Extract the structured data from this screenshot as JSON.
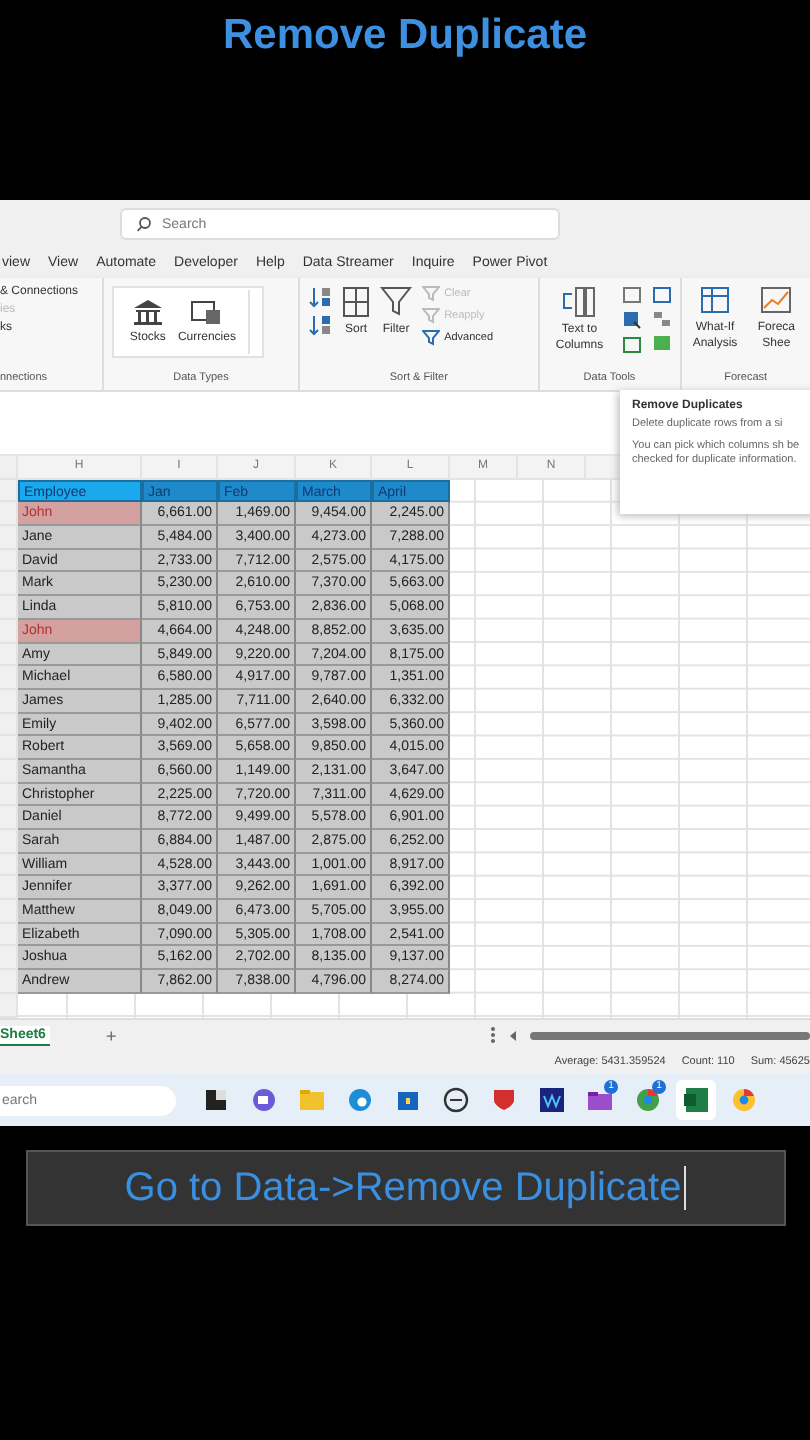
{
  "video_title": "Remove Duplicate",
  "search": {
    "placeholder": "Search"
  },
  "menu_tabs": [
    {
      "label": "view",
      "selected": false
    },
    {
      "label": "View",
      "selected": false
    },
    {
      "label": "Automate",
      "selected": false
    },
    {
      "label": "Developer",
      "selected": false
    },
    {
      "label": "Help",
      "selected": false
    },
    {
      "label": "Data Streamer",
      "selected": false
    },
    {
      "label": "Inquire",
      "selected": false
    },
    {
      "label": "Power Pivot",
      "selected": false
    }
  ],
  "ribbon": {
    "connections": {
      "items": [
        {
          "label": "& Connections",
          "disabled": false
        },
        {
          "label": "ies",
          "disabled": true
        },
        {
          "label": "ks",
          "disabled": false
        }
      ],
      "group": "nnections"
    },
    "data_types": {
      "buttons": [
        "Stocks",
        "Currencies"
      ],
      "group": "Data Types"
    },
    "sort_filter": {
      "sort": "Sort",
      "filter": "Filter",
      "items": [
        {
          "label": "Clear",
          "disabled": true
        },
        {
          "label": "Reapply",
          "disabled": true
        },
        {
          "label": "Advanced",
          "disabled": false
        }
      ],
      "group": "Sort & Filter"
    },
    "data_tools": {
      "text_to_columns": "Text to Columns",
      "group": "Data Tools"
    },
    "forecast": {
      "what_if": "What-If Analysis",
      "forecast_sheet": "Foreca Shee",
      "group": "Forecast"
    }
  },
  "tooltip": {
    "title": "Remove Duplicates",
    "line_1": "Delete duplicate rows from a si",
    "line_2": "You can pick which columns sh be checked for duplicate information."
  },
  "sheet": {
    "columns": [
      "H",
      "I",
      "J",
      "K",
      "L",
      "M",
      "N"
    ],
    "header": [
      "Employee",
      "Jan",
      "Feb",
      "March",
      "April"
    ],
    "rows": [
      {
        "name": "John",
        "duplicate": true,
        "values": [
          "6,661.00",
          "1,469.00",
          "9,454.00",
          "2,245.00"
        ]
      },
      {
        "name": "Jane",
        "duplicate": false,
        "values": [
          "5,484.00",
          "3,400.00",
          "4,273.00",
          "7,288.00"
        ]
      },
      {
        "name": "David",
        "duplicate": false,
        "values": [
          "2,733.00",
          "7,712.00",
          "2,575.00",
          "4,175.00"
        ]
      },
      {
        "name": "Mark",
        "duplicate": false,
        "values": [
          "5,230.00",
          "2,610.00",
          "7,370.00",
          "5,663.00"
        ]
      },
      {
        "name": "Linda",
        "duplicate": false,
        "values": [
          "5,810.00",
          "6,753.00",
          "2,836.00",
          "5,068.00"
        ]
      },
      {
        "name": "John",
        "duplicate": true,
        "values": [
          "4,664.00",
          "4,248.00",
          "8,852.00",
          "3,635.00"
        ]
      },
      {
        "name": "Amy",
        "duplicate": false,
        "values": [
          "5,849.00",
          "9,220.00",
          "7,204.00",
          "8,175.00"
        ]
      },
      {
        "name": "Michael",
        "duplicate": false,
        "values": [
          "6,580.00",
          "4,917.00",
          "9,787.00",
          "1,351.00"
        ]
      },
      {
        "name": "James",
        "duplicate": false,
        "values": [
          "1,285.00",
          "7,711.00",
          "2,640.00",
          "6,332.00"
        ]
      },
      {
        "name": "Emily",
        "duplicate": false,
        "values": [
          "9,402.00",
          "6,577.00",
          "3,598.00",
          "5,360.00"
        ]
      },
      {
        "name": "Robert",
        "duplicate": false,
        "values": [
          "3,569.00",
          "5,658.00",
          "9,850.00",
          "4,015.00"
        ]
      },
      {
        "name": "Samantha",
        "duplicate": false,
        "values": [
          "6,560.00",
          "1,149.00",
          "2,131.00",
          "3,647.00"
        ]
      },
      {
        "name": "Christopher",
        "duplicate": false,
        "values": [
          "2,225.00",
          "7,720.00",
          "7,311.00",
          "4,629.00"
        ]
      },
      {
        "name": "Daniel",
        "duplicate": false,
        "values": [
          "8,772.00",
          "9,499.00",
          "5,578.00",
          "6,901.00"
        ]
      },
      {
        "name": "Sarah",
        "duplicate": false,
        "values": [
          "6,884.00",
          "1,487.00",
          "2,875.00",
          "6,252.00"
        ]
      },
      {
        "name": "William",
        "duplicate": false,
        "values": [
          "4,528.00",
          "3,443.00",
          "1,001.00",
          "8,917.00"
        ]
      },
      {
        "name": "Jennifer",
        "duplicate": false,
        "values": [
          "3,377.00",
          "9,262.00",
          "1,691.00",
          "6,392.00"
        ]
      },
      {
        "name": "Matthew",
        "duplicate": false,
        "values": [
          "8,049.00",
          "6,473.00",
          "5,705.00",
          "3,955.00"
        ]
      },
      {
        "name": "Elizabeth",
        "duplicate": false,
        "values": [
          "7,090.00",
          "5,305.00",
          "1,708.00",
          "2,541.00"
        ]
      },
      {
        "name": "Joshua",
        "duplicate": false,
        "values": [
          "5,162.00",
          "2,702.00",
          "8,135.00",
          "9,137.00"
        ]
      },
      {
        "name": "Andrew",
        "duplicate": false,
        "values": [
          "7,862.00",
          "7,838.00",
          "4,796.00",
          "8,274.00"
        ]
      }
    ]
  },
  "sheet_tabs": [
    {
      "label": "Sheet6",
      "selected": true
    }
  ],
  "add_sheet": "+",
  "status_bar": [
    "Average: 5431.359524",
    "Count: 110",
    "Sum: 45625"
  ],
  "taskbar": {
    "search_placeholder": "earch",
    "badges": [
      "1",
      "1"
    ]
  },
  "caption": "Go to Data->Remove Duplicate"
}
